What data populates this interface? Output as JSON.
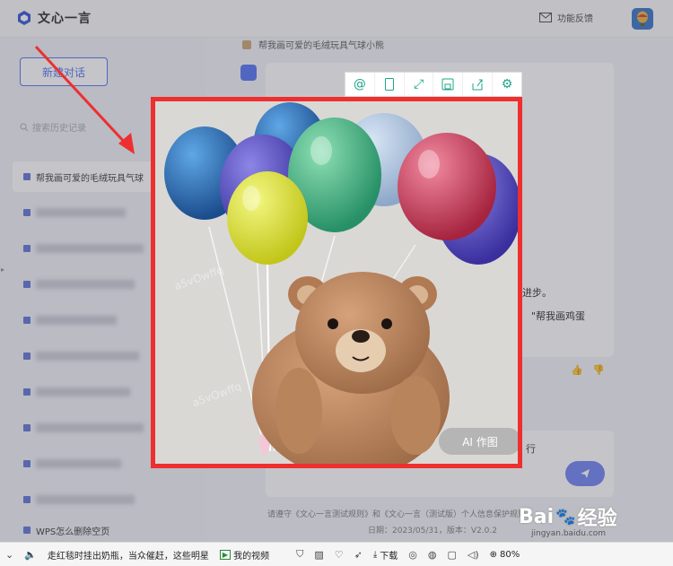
{
  "app": {
    "name": "文心一言",
    "feedback_label": "功能反馈"
  },
  "sidebar": {
    "new_chat_label": "新建对话",
    "search_placeholder": "搜索历史记录",
    "active_item_label": "帮我画可爱的毛绒玩具气球",
    "last_item_label": "WPS怎么删除空页"
  },
  "main": {
    "user_prompt": "帮我画可爱的毛绒玩具气球小熊",
    "answer_fragment_1": "进步。",
    "answer_fragment_2": "\"帮我画鸡蛋",
    "input_hint_fragment": "行",
    "footer_line1": "请遵守《文心一言测试规则》和《文心一言（测试版）个人信息保护规则》",
    "footer_line2": "日期：2023/05/31，版本：V2.0.2"
  },
  "preview": {
    "toolbar_icons": [
      "at-icon",
      "phone-frame-icon",
      "expand-icon",
      "save-icon",
      "share-icon",
      "settings-icon"
    ],
    "ai_badge": "AI 作图",
    "watermark": "a5vOwffq",
    "border_color": "#ee2f2f"
  },
  "brand": {
    "watermark_word": "Bai",
    "watermark_word2": "经验",
    "watermark_url": "jingyan.baidu.com"
  },
  "taskbar": {
    "news_text": "走红毯时挂出奶瓶，当众催赶，这些明星",
    "video_label": "我的视频",
    "download_label": "下载",
    "zoom_label": "80%"
  }
}
